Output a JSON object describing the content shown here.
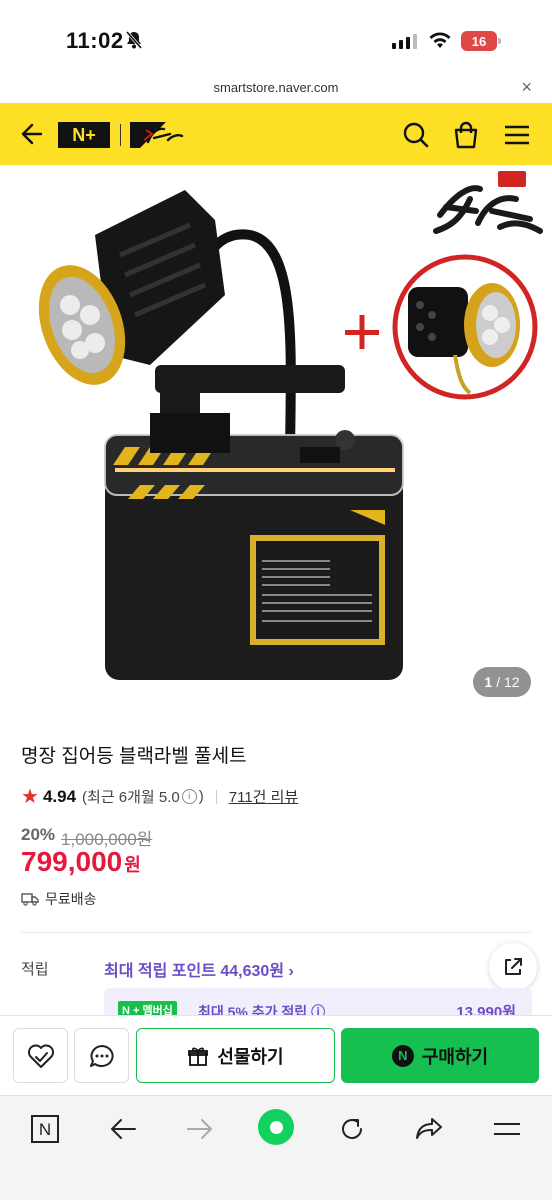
{
  "status_bar": {
    "time": "11:02",
    "battery": "16"
  },
  "browser": {
    "url": "smartstore.naver.com"
  },
  "header": {
    "nplus_label": "N+"
  },
  "gallery": {
    "current": "1",
    "total": "/ 12"
  },
  "product": {
    "title": "명장 집어등 블랙라벨 풀세트",
    "rating": "4.94",
    "rating_detail": "(최근 6개월 5.0",
    "rating_close": ")",
    "info_mark": "i",
    "review_count": "711건 리뷰",
    "discount_rate": "20%",
    "original_price": "1,000,000원",
    "price": "799,000",
    "price_unit": "원",
    "shipping": "무료배송"
  },
  "points": {
    "label": "적립",
    "value": "최대 적립 포인트 44,630원 ›"
  },
  "membership": {
    "badge": "N + 멤버십",
    "text": "최대 5% 추가 적립 ⓘ",
    "amount": "13,990원"
  },
  "actions": {
    "gift_label": "선물하기",
    "buy_label": "구매하기",
    "buy_n": "N"
  },
  "toolbar": {
    "tabs_label": "N"
  },
  "colors": {
    "header_yellow": "#fde025",
    "price_red": "#e7183e",
    "naver_green": "#16c050",
    "points_purple": "#6b4ec6"
  }
}
